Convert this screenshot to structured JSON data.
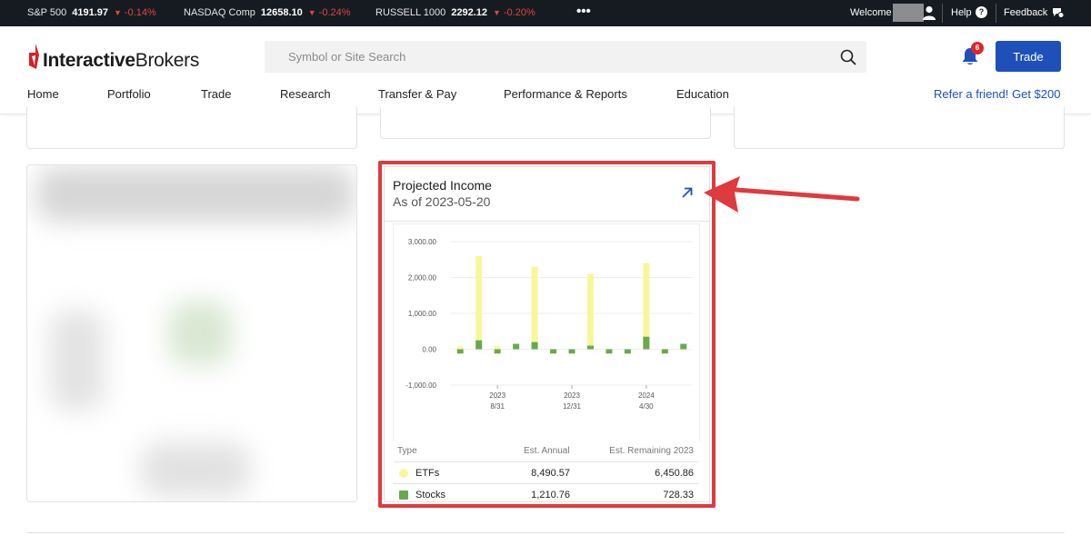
{
  "ticker": {
    "items": [
      {
        "name": "S&P 500",
        "value": "4191.97",
        "change": "-0.14%"
      },
      {
        "name": "NASDAQ Comp",
        "value": "12658.10",
        "change": "-0.24%"
      },
      {
        "name": "RUSSELL 1000",
        "value": "2292.12",
        "change": "-0.20%"
      }
    ],
    "more": "•••",
    "welcome": "Welcome",
    "help": "Help",
    "feedback": "Feedback"
  },
  "header": {
    "logo_bold": "Interactive",
    "logo_rest": "Brokers",
    "search_placeholder": "Symbol or Site Search",
    "notifications_count": "6",
    "trade_label": "Trade"
  },
  "nav": {
    "items": [
      "Home",
      "Portfolio",
      "Trade",
      "Research",
      "Transfer & Pay",
      "Performance & Reports",
      "Education"
    ],
    "refer": "Refer a friend! Get $200"
  },
  "projected_income": {
    "title": "Projected Income",
    "subtitle": "As of 2023-05-20",
    "table": {
      "headers": [
        "Type",
        "Est. Annual",
        "Est. Remaining 2023"
      ],
      "rows": [
        {
          "type": "ETFs",
          "annual": "8,490.57",
          "remaining": "6,450.86",
          "color": "#f7f79a"
        },
        {
          "type": "Stocks",
          "annual": "1,210.76",
          "remaining": "728.33",
          "color": "#6aa84f"
        }
      ]
    }
  },
  "chart_data": {
    "type": "bar",
    "title": "",
    "xlabel": "",
    "ylabel": "",
    "ylim": [
      -1000,
      3000
    ],
    "ytick_labels": [
      "3,000.00",
      "2,000.00",
      "1,000.00",
      "0.00",
      "-1,000.00"
    ],
    "yticks": [
      3000,
      2000,
      1000,
      0,
      -1000
    ],
    "xtick_labels": [
      [
        "2023",
        "8/31"
      ],
      [
        "2023",
        "12/31"
      ],
      [
        "2024",
        "4/30"
      ]
    ],
    "xtick_positions": [
      2.5,
      6.5,
      10.5
    ],
    "bar_count": 13,
    "series": [
      {
        "name": "ETFs",
        "color": "#f7f79a",
        "values": [
          80,
          2600,
          80,
          80,
          2300,
          0,
          0,
          2100,
          0,
          0,
          2400,
          0,
          0
        ]
      },
      {
        "name": "Stocks",
        "color": "#6aa84f",
        "values": [
          -120,
          250,
          -120,
          150,
          200,
          -120,
          -120,
          100,
          -120,
          -120,
          350,
          -120,
          150
        ]
      }
    ],
    "grid": true,
    "legend": "table-below"
  }
}
